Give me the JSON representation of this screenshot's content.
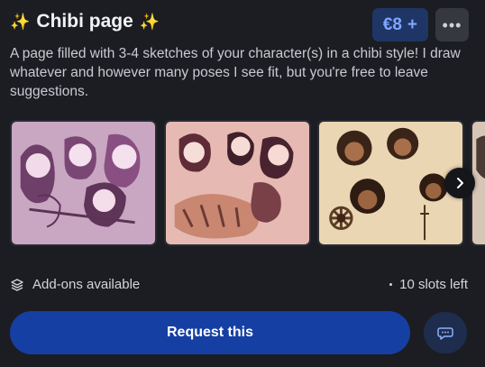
{
  "header": {
    "title": "Chibi page",
    "sparkle_left": "✨",
    "sparkle_right": "✨",
    "price": "€8",
    "price_plus": "+",
    "more_icon": "more-horizontal-icon"
  },
  "description": "A page filled with 3-4 sketches of your character(s) in a chibi style! I draw whatever and however many poses I see fit, but you're free to leave suggestions.",
  "carousel": {
    "images": [
      {
        "alt": "chibi sketches of a horned character"
      },
      {
        "alt": "chibi sketches of two characters with a tiger"
      },
      {
        "alt": "chibi sketches of a curly-haired character with flowers"
      },
      {
        "alt": "partial fourth sketch"
      }
    ],
    "next_icon": "chevron-right-icon"
  },
  "footer": {
    "addons_label": "Add-ons available",
    "addons_icon": "layers-icon",
    "slots_label": "10 slots left",
    "request_label": "Request this",
    "chat_icon": "chat-bubble-icon"
  },
  "colors": {
    "background": "#1c1d22",
    "accent": "#163fa3",
    "price_bg": "#1e3566",
    "price_text": "#7fa6ff"
  }
}
